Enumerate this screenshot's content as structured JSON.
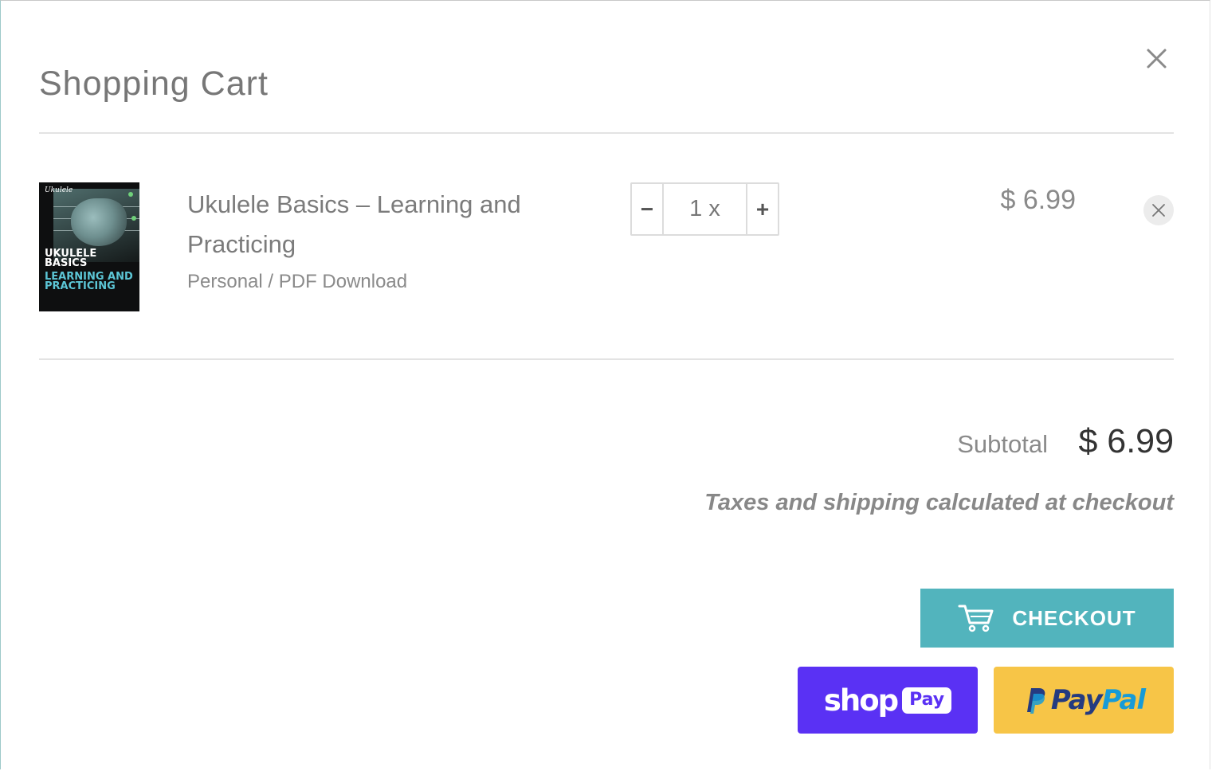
{
  "cart": {
    "title": "Shopping Cart",
    "close_icon": "close-icon"
  },
  "item": {
    "title": "Ukulele Basics – Learning and Practicing",
    "variant": "Personal / PDF Download",
    "quantity": "1 x",
    "minus_label": "−",
    "plus_label": "+",
    "price": "$ 6.99",
    "remove_icon": "remove-x-icon",
    "thumbnail": {
      "brand": "Ukulele",
      "line1": "UKULELE BASICS",
      "line2": "LEARNING AND PRACTICING"
    }
  },
  "summary": {
    "subtotal_label": "Subtotal",
    "subtotal_value": "$ 6.99",
    "taxes_note": "Taxes and shipping calculated at checkout"
  },
  "actions": {
    "checkout_label": "CHECKOUT",
    "checkout_icon": "cart-icon",
    "shoppay_shop": "shop",
    "shoppay_pay": "Pay",
    "paypal_pay": "Pay",
    "paypal_pal": "Pal"
  },
  "colors": {
    "accent": "#52b4bd",
    "shoppay": "#5a31f4",
    "paypal": "#f7c547"
  }
}
